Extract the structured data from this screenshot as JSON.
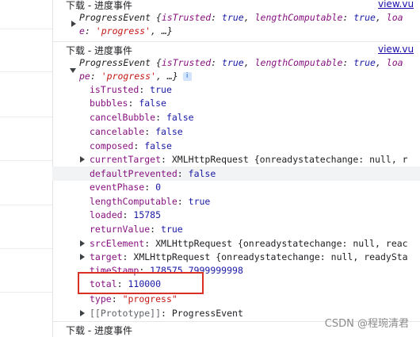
{
  "messages": [
    {
      "title": "下载 - 进度事件",
      "link": "view.vu",
      "summary": {
        "prefix": "ProgressEvent {",
        "k1": "isTrusted",
        "v1": "true",
        "k2": "lengthComputable",
        "v2": "true",
        "k3": "loa",
        "cont_key": "e",
        "cont_val": "'progress'",
        "cont_tail": ", …}"
      }
    },
    {
      "title": "下载 - 进度事件",
      "link": "view.vu",
      "summary": {
        "prefix": "ProgressEvent {",
        "k1": "isTrusted",
        "v1": "true",
        "k2": "lengthComputable",
        "v2": "true",
        "k3": "loa",
        "cont_key": "pe",
        "cont_val": "'progress'",
        "cont_tail": ", …}",
        "info_icon": "i"
      },
      "props": [
        {
          "key": "isTrusted",
          "value": "true",
          "type": "kw"
        },
        {
          "key": "bubbles",
          "value": "false",
          "type": "kw"
        },
        {
          "key": "cancelBubble",
          "value": "false",
          "type": "kw"
        },
        {
          "key": "cancelable",
          "value": "false",
          "type": "kw"
        },
        {
          "key": "composed",
          "value": "false",
          "type": "kw"
        },
        {
          "key": "currentTarget",
          "value": "XMLHttpRequest {onreadystatechange: null, r",
          "type": "obj"
        },
        {
          "key": "defaultPrevented",
          "value": "false",
          "type": "kw"
        },
        {
          "key": "eventPhase",
          "value": "0",
          "type": "num"
        },
        {
          "key": "lengthComputable",
          "value": "true",
          "type": "kw"
        },
        {
          "key": "loaded",
          "value": "15785",
          "type": "num"
        },
        {
          "key": "returnValue",
          "value": "true",
          "type": "kw"
        },
        {
          "key": "srcElement",
          "value": "XMLHttpRequest {onreadystatechange: null, reac",
          "type": "obj"
        },
        {
          "key": "target",
          "value": "XMLHttpRequest {onreadystatechange: null, readySta",
          "type": "obj"
        },
        {
          "key": "timeStamp",
          "value": "178575.7999999998",
          "type": "num"
        },
        {
          "key": "total",
          "value": "110000",
          "type": "num"
        },
        {
          "key": "type",
          "value": "\"progress\"",
          "type": "str"
        },
        {
          "key": "[[Prototype]]",
          "value": "ProgressEvent",
          "type": "proto"
        }
      ]
    },
    {
      "title": "下载 - 进度事件"
    }
  ],
  "watermark": "CSDN @程琬清君",
  "colors": {
    "annotation_box": "#d93025",
    "property_key": "#881280",
    "keyword": "#1a1aa6",
    "string": "#c41a16",
    "link": "#1a0dab"
  }
}
